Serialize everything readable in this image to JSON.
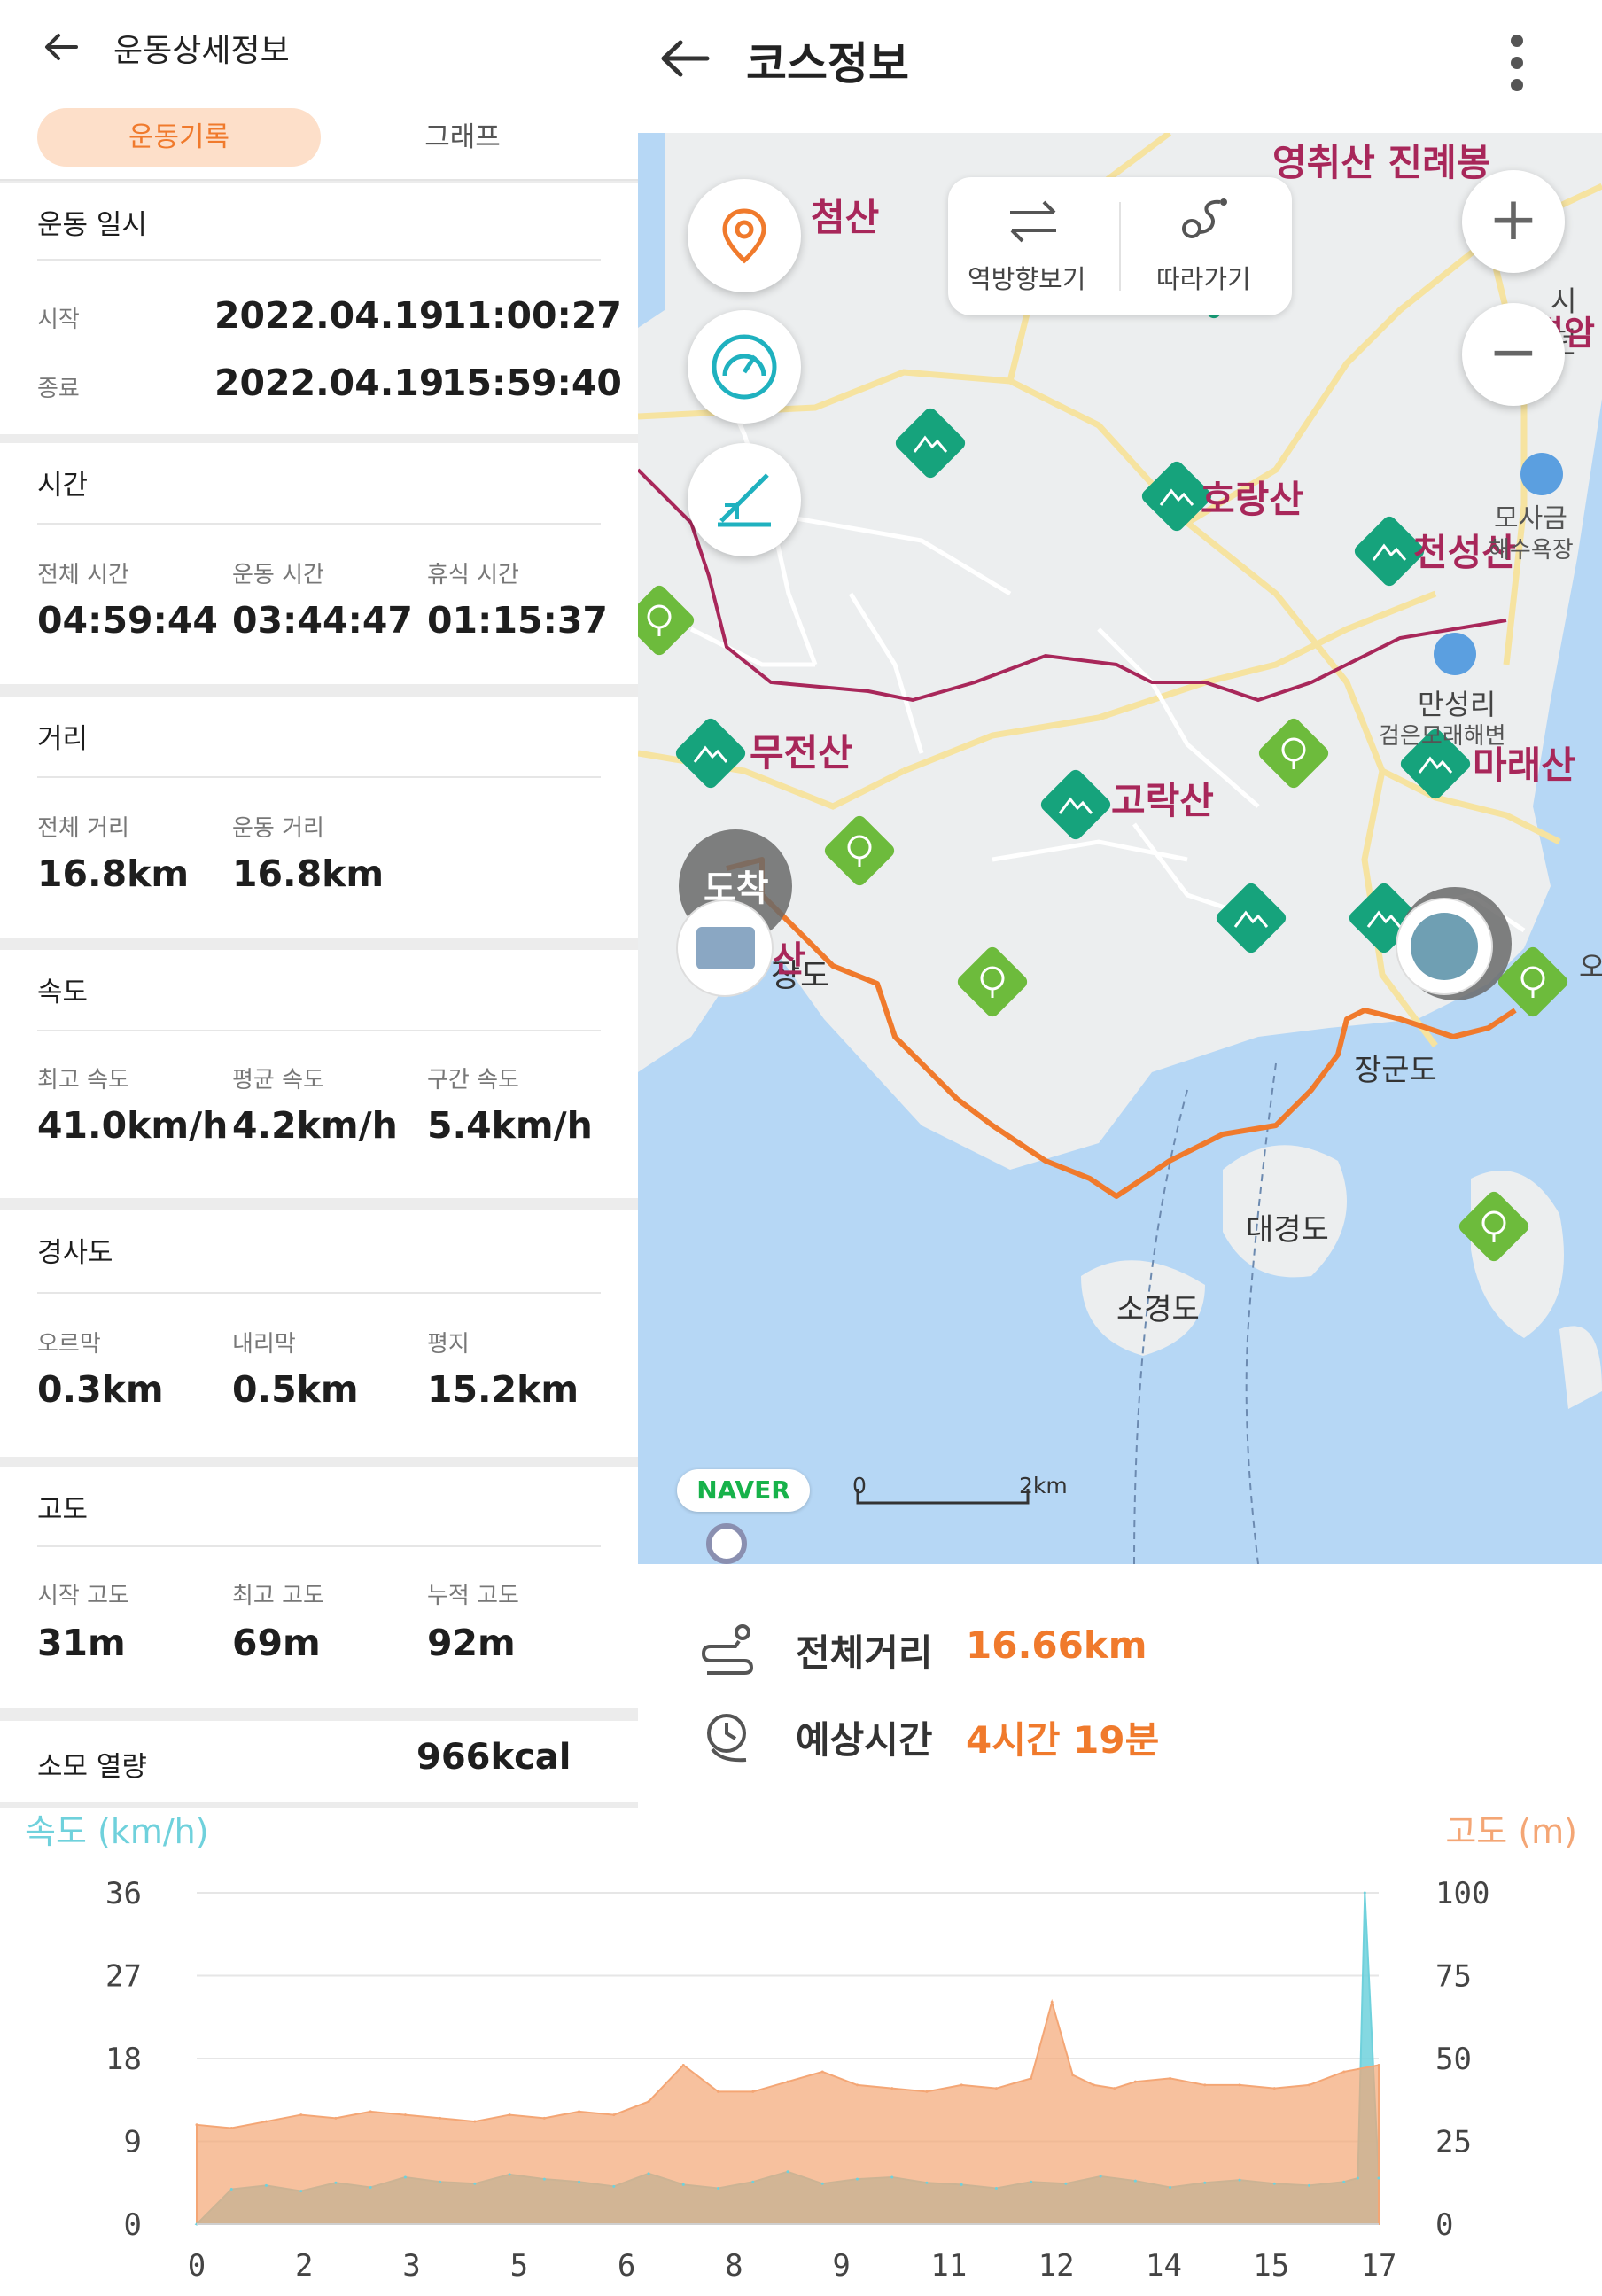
{
  "left": {
    "title": "운동상세정보",
    "tabs": {
      "record": "운동기록",
      "graph": "그래프"
    },
    "datetime": {
      "heading": "운동 일시",
      "start_label": "시작",
      "start_date": "2022.04.19",
      "start_time": "11:00:27",
      "end_label": "종료",
      "end_date": "2022.04.19",
      "end_time": "15:59:40"
    },
    "time": {
      "heading": "시간",
      "items": [
        {
          "label": "전체 시간",
          "value": "04:59:44"
        },
        {
          "label": "운동 시간",
          "value": "03:44:47"
        },
        {
          "label": "휴식 시간",
          "value": "01:15:37"
        }
      ]
    },
    "distance": {
      "heading": "거리",
      "items": [
        {
          "label": "전체 거리",
          "value": "16.8km"
        },
        {
          "label": "운동 거리",
          "value": "16.8km"
        }
      ]
    },
    "speed": {
      "heading": "속도",
      "items": [
        {
          "label": "최고 속도",
          "value": "41.0km/h"
        },
        {
          "label": "평균 속도",
          "value": "4.2km/h"
        },
        {
          "label": "구간 속도",
          "value": "5.4km/h"
        }
      ]
    },
    "slope": {
      "heading": "경사도",
      "items": [
        {
          "label": "오르막",
          "value": "0.3km"
        },
        {
          "label": "내리막",
          "value": "0.5km"
        },
        {
          "label": "평지",
          "value": "15.2km"
        }
      ]
    },
    "altitude": {
      "heading": "고도",
      "items": [
        {
          "label": "시작 고도",
          "value": "31m"
        },
        {
          "label": "최고 고도",
          "value": "69m"
        },
        {
          "label": "누적 고도",
          "value": "92m"
        }
      ]
    },
    "calories": {
      "label": "소모 열량",
      "value": "966kcal"
    }
  },
  "right": {
    "title": "코스정보",
    "map": {
      "reverse_label": "역방향보기",
      "follow_label": "따라가기",
      "zoom_in": "+",
      "zoom_out": "−",
      "arrival_label": "도착",
      "naver_logo": "NAVER",
      "scale_start": "0",
      "scale_end": "2km",
      "places": {
        "cheomsan": "첨산",
        "yeongchwisan": "영취산 진례봉",
        "horangsan": "호랑산",
        "cheonseongsan": "천성산",
        "mosageum": "모사금",
        "yokjang": "해수욕장",
        "mujeonsan": "무전산",
        "goraksan": "고락산",
        "mallaesan": "마래산",
        "manseongri": "만성리",
        "geomeun": "검은모래해변",
        "jangdo": "장도",
        "jangundo": "장군도",
        "daegyeongdo": "대경도",
        "sogyeongdo": "소경도",
        "san_label": "산",
        "partial_top": "시던",
        "partial_top2": "결암",
        "o_label": "오"
      },
      "colors": {
        "route": "#f07a2c",
        "bike_road": "#a8275a",
        "water": "#b6d7f5",
        "land": "#eceeef",
        "park": "#16a37c"
      }
    },
    "total_distance_label": "전체거리",
    "total_distance_value": "16.66km",
    "est_time_label": "예상시간",
    "est_time_value": "4시간 19분"
  },
  "chart_data": {
    "type": "area",
    "speed_label": "속도 (km/h)",
    "altitude_label": "고도 (m)",
    "x_ticks": [
      "0",
      "2",
      "3",
      "5",
      "6",
      "8",
      "9",
      "11",
      "12",
      "14",
      "15",
      "17"
    ],
    "y_left_ticks": [
      "36",
      "27",
      "18",
      "9",
      "0"
    ],
    "y_right_ticks": [
      "100",
      "75",
      "50",
      "25",
      "0"
    ],
    "ylim_left": [
      0,
      36
    ],
    "ylim_right": [
      0,
      100
    ],
    "xlim": [
      0,
      17
    ],
    "grid": true,
    "series": [
      {
        "name": "속도 (km/h)",
        "axis": "left",
        "color": "#6fd1dc",
        "x": [
          0,
          0.5,
          1,
          1.5,
          2,
          2.5,
          3,
          3.5,
          4,
          4.5,
          5,
          5.5,
          6,
          6.5,
          7,
          7.5,
          8,
          8.5,
          9,
          9.5,
          10,
          10.5,
          11,
          11.5,
          12,
          12.5,
          13,
          13.5,
          14,
          14.5,
          15,
          15.5,
          16,
          16.5,
          16.7,
          16.8,
          17
        ],
        "values": [
          0,
          3.8,
          4.2,
          3.6,
          4.5,
          4.0,
          5.1,
          4.6,
          4.4,
          5.4,
          4.9,
          4.6,
          4.1,
          5.5,
          4.3,
          3.9,
          4.6,
          5.7,
          4.4,
          4.9,
          5.1,
          4.5,
          4.3,
          3.9,
          4.6,
          4.4,
          5.2,
          4.7,
          4.0,
          4.5,
          4.8,
          4.4,
          4.2,
          4.6,
          5.0,
          36,
          5.0
        ]
      },
      {
        "name": "고도 (m)",
        "axis": "right",
        "color": "#f4a675",
        "x": [
          0,
          0.5,
          1,
          1.5,
          2,
          2.5,
          3,
          3.5,
          4,
          4.5,
          5,
          5.5,
          6,
          6.5,
          7,
          7.5,
          8,
          8.5,
          9,
          9.5,
          10,
          10.5,
          11,
          11.5,
          12,
          12.3,
          12.6,
          12.9,
          13.2,
          13.5,
          14,
          14.5,
          15,
          15.5,
          16,
          16.5,
          17
        ],
        "values": [
          30,
          29,
          31,
          33,
          32,
          34,
          33,
          32,
          31,
          33,
          32,
          34,
          33,
          37,
          48,
          40,
          40,
          43,
          46,
          42,
          41,
          40,
          42,
          41,
          44,
          67,
          45,
          42,
          41,
          43,
          44,
          42,
          42,
          41,
          42,
          46,
          48
        ]
      }
    ]
  }
}
